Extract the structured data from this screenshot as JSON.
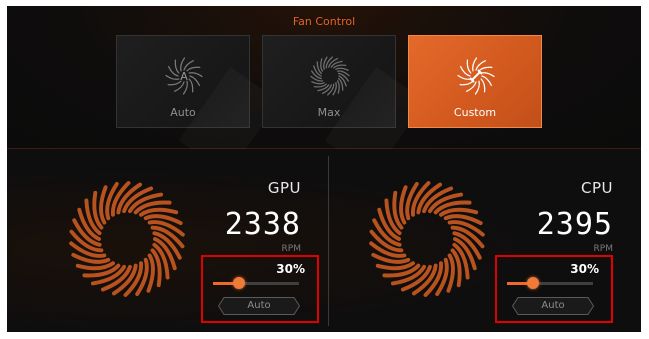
{
  "header": {
    "title": "Fan Control"
  },
  "modes": [
    {
      "label": "Auto",
      "icon": "fan-auto-icon",
      "active": false
    },
    {
      "label": "Max",
      "icon": "fan-max-icon",
      "active": false
    },
    {
      "label": "Custom",
      "icon": "fan-custom-icon",
      "active": true
    }
  ],
  "gpu": {
    "name": "GPU",
    "rpm": "2338",
    "unit": "RPM",
    "percent_label": "30%",
    "level": 0.3,
    "auto_label": "Auto"
  },
  "cpu": {
    "name": "CPU",
    "rpm": "2395",
    "unit": "RPM",
    "percent_label": "30%",
    "level": 0.3,
    "auto_label": "Auto"
  },
  "colors": {
    "accent": "#e4692b",
    "highlight_box": "#e00000",
    "background": "#0e0e0e"
  }
}
